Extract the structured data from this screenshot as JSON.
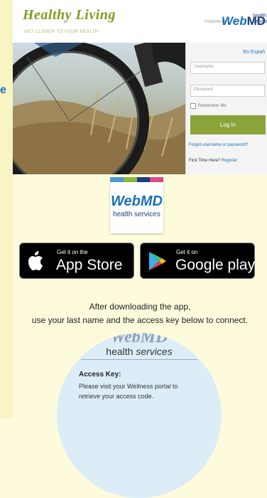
{
  "side": {
    "letter": "e"
  },
  "header": {
    "brand": "Healthy Living",
    "tagline": "GET CLOSER TO YOUR HEALTH",
    "powered": "POWERED BY",
    "webmd_prefix": "Web",
    "webmd_suffix": "MD",
    "health_services": "health services"
  },
  "login": {
    "language": "En Españ",
    "username_placeholder": "Username",
    "password_placeholder": "Password",
    "remember_label": "Remember Me",
    "login_button": "Log In",
    "forgot_link": "Forgot username or password?",
    "first_time": "First Time Here?",
    "register_link": "Register"
  },
  "color_bars": [
    "#4d9ad6",
    "#8cb83c",
    "#1c3f7a",
    "#e0468c"
  ],
  "logo": {
    "webmd": "WebMD",
    "subtitle": "health services"
  },
  "badges": {
    "app_store": {
      "small": "Get it on the",
      "big": "App Store"
    },
    "google_play": {
      "small": "Get it on",
      "big": "Google play"
    }
  },
  "message": {
    "line1": "After downloading the app,",
    "line2": "use your last name and the access key below to connect."
  },
  "card": {
    "cut_text": "WebMD",
    "health": "health",
    "services": "services",
    "access_key_label": "Access Key:",
    "access_key_text": "Please visit your Wellness portal to retrieve your access code."
  }
}
